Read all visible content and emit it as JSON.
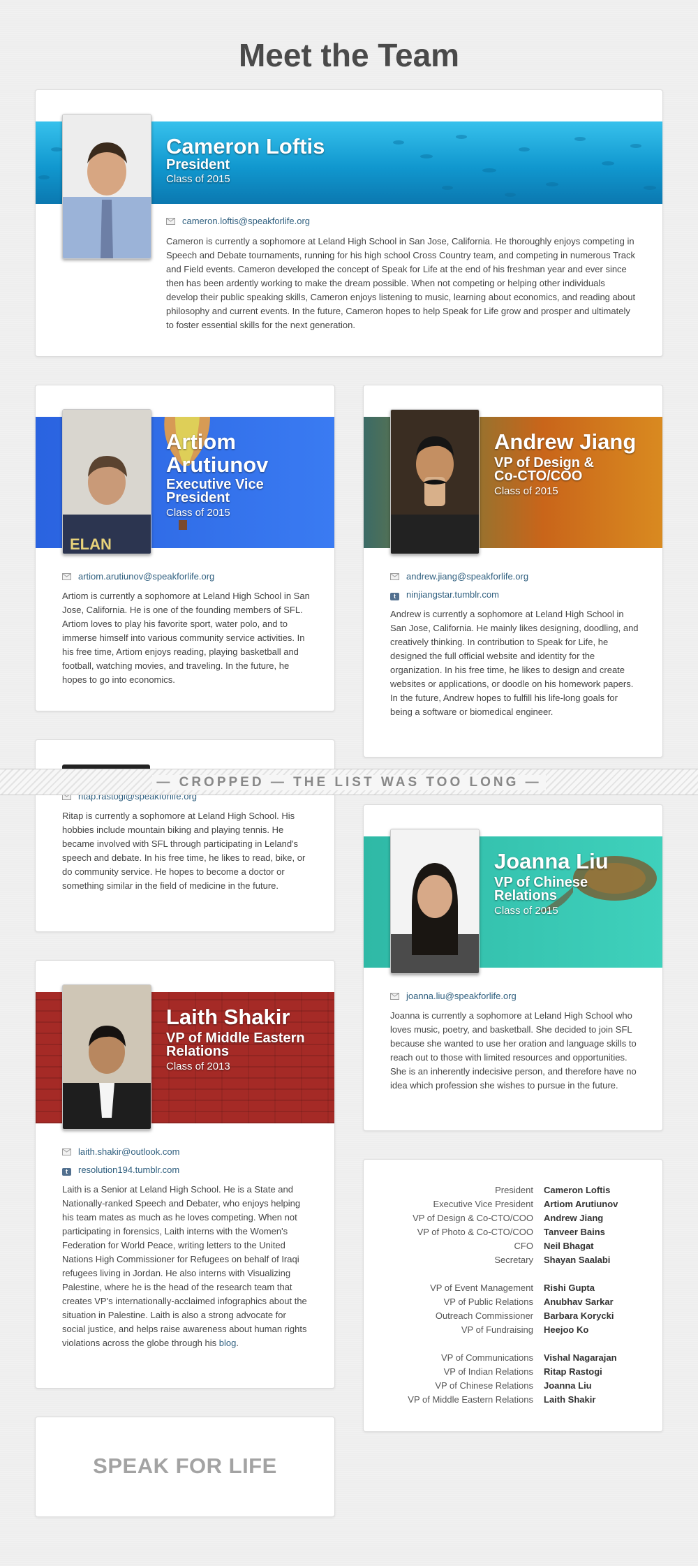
{
  "page": {
    "title": "Meet the Team"
  },
  "members": {
    "cameron": {
      "name": "Cameron Loftis",
      "role": "President",
      "class_year": "Class of 2015",
      "email": "cameron.loftis@speakforlife.org",
      "bio": "Cameron is currently a sophomore at Leland High School in San Jose, California. He thoroughly enjoys competing in Speech and Debate tournaments, running for his high school Cross Country team, and competing in numerous Track and Field events. Cameron developed the concept of Speak for Life at the end of his freshman year and ever since then has been ardently working to make the dream possible. When not competing or helping other individuals develop their public speaking skills, Cameron enjoys listening to music, learning about economics, and reading about philosophy and current events. In the future, Cameron hopes to help Speak for Life grow and prosper and ultimately to foster essential skills for the next generation."
    },
    "artiom": {
      "name_line1": "Artiom",
      "name_line2": "Arutiunov",
      "role_line1": "Executive Vice",
      "role_line2": "President",
      "class_year": "Class of 2015",
      "email": "artiom.arutiunov@speakforlife.org",
      "bio": "Artiom is currently a sophomore at Leland High School in San Jose, California. He is one of the founding members of SFL. Artiom loves to play his favorite sport, water polo, and to immerse himself into various community service activities. In his free time, Artiom enjoys reading, playing basketball and football, watching movies, and traveling. In the future, he hopes to go into economics."
    },
    "andrew": {
      "name": "Andrew Jiang",
      "role_line1": "VP of Design &",
      "role_line2": "Co-CTO/COO",
      "class_year": "Class of 2015",
      "email": "andrew.jiang@speakforlife.org",
      "tumblr": "ninjiangstar.tumblr.com",
      "bio": "Andrew is currently a sophomore at Leland High School in San Jose, California. He mainly likes designing, doodling, and creatively thinking. In contribution to Speak for Life, he designed the full official website and identity for the organization. In his free time, he likes to design and create websites or applications, or doodle on his homework papers. In the future, Andrew hopes to fulfill his life-long goals for being a software or biomedical engineer."
    },
    "ritap": {
      "email": "ritap.rastogi@speakforlife.org",
      "bio": "Ritap is currently a sophomore at Leland High School. His hobbies include mountain biking and playing tennis. He became involved with SFL through participating in Leland's speech and debate. In his free time, he likes to read, bike, or do community service. He hopes to become a doctor or something similar in the field of medicine in the future."
    },
    "joanna": {
      "name": "Joanna Liu",
      "role_line1": "VP of Chinese",
      "role_line2": "Relations",
      "class_year": "Class of 2015",
      "email": "joanna.liu@speakforlife.org",
      "bio": "Joanna is currently a sophomore at Leland High School who loves music, poetry, and basketball. She decided to join SFL because she wanted to use her oration and language skills to reach out to those with limited resources and opportunities. She is an inherently indecisive person, and therefore have no idea which profession she wishes to pursue in the future."
    },
    "laith": {
      "name": "Laith Shakir",
      "role_line1": "VP of Middle Eastern",
      "role_line2": "Relations",
      "class_year": "Class of 2013",
      "email": "laith.shakir@outlook.com",
      "tumblr": "resolution194.tumblr.com",
      "bio": "Laith is a Senior at Leland High School. He is a State and Nationally-ranked Speech and Debater, who enjoys helping his team mates as much as he loves competing. When not participating in forensics, Laith interns with the Women's Federation for World Peace, writing letters to the United Nations High Commissioner for Refugees on behalf of Iraqi refugees living in Jordan. He also interns with Visualizing Palestine, where he is the head of the research team that creates VP's internationally-acclaimed infographics about the situation in Palestine. Laith is also a strong advocate for social justice, and helps raise awareness about human rights violations across the globe through his ",
      "bio_link": "blog",
      "bio_end": "."
    }
  },
  "cropped_notice": "— CROPPED — THE LIST WAS TOO LONG —",
  "roster": [
    {
      "role": "President",
      "name": "Cameron Loftis"
    },
    {
      "role": "Executive Vice President",
      "name": "Artiom Arutiunov"
    },
    {
      "role": "VP of Design & Co-CTO/COO",
      "name": "Andrew Jiang"
    },
    {
      "role": "VP of Photo & Co-CTO/COO",
      "name": "Tanveer Bains"
    },
    {
      "role": "CFO",
      "name": "Neil Bhagat"
    },
    {
      "role": "Secretary",
      "name": "Shayan Saalabi"
    },
    {
      "role": "",
      "name": ""
    },
    {
      "role": "VP of Event Management",
      "name": "Rishi Gupta"
    },
    {
      "role": "VP of Public Relations",
      "name": "Anubhav Sarkar"
    },
    {
      "role": "Outreach Commissioner",
      "name": "Barbara Korycki"
    },
    {
      "role": "VP of Fundraising",
      "name": "Heejoo Ko"
    },
    {
      "role": "",
      "name": ""
    },
    {
      "role": "VP of Communications",
      "name": "Vishal Nagarajan"
    },
    {
      "role": "VP of Indian Relations",
      "name": "Ritap Rastogi"
    },
    {
      "role": "VP of Chinese Relations",
      "name": "Joanna Liu"
    },
    {
      "role": "VP of Middle Eastern Relations",
      "name": "Laith Shakir"
    }
  ],
  "footer": {
    "logo_text": "SPEAK FOR LIFE"
  },
  "colors": {
    "banner_ocean": "#1aa6d8",
    "banner_blue": "#2f6ee8",
    "banner_orange": "#c9651a",
    "banner_teal": "#35c6b0",
    "banner_red": "#a52a26",
    "link": "#2f5f7f"
  },
  "icons": [
    "mail-icon",
    "tumblr-icon"
  ]
}
